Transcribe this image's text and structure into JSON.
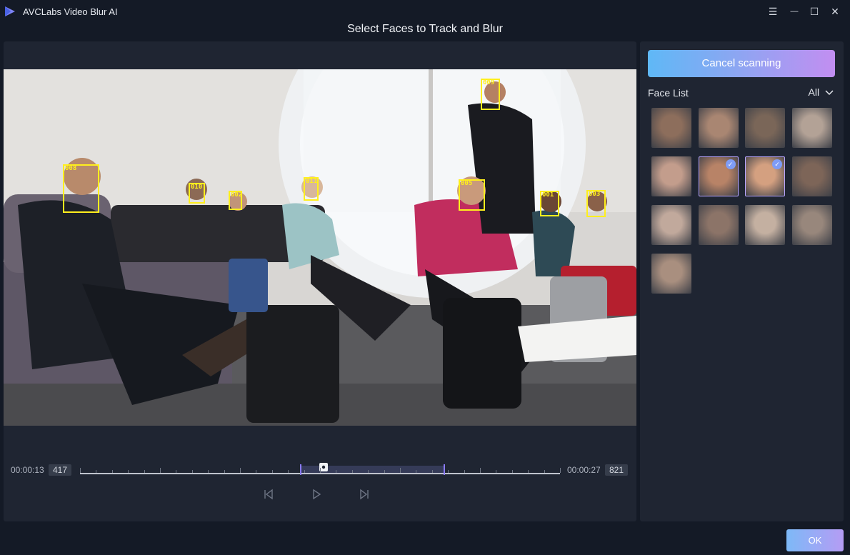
{
  "app": {
    "title": "AVCLabs Video Blur AI"
  },
  "page": {
    "title": "Select Faces to Track and Blur"
  },
  "window_controls": [
    {
      "name": "menu-icon",
      "glyph": "☰"
    },
    {
      "name": "minimize-icon",
      "glyph": "—"
    },
    {
      "name": "maximize-icon",
      "glyph": "☐"
    },
    {
      "name": "close-icon",
      "glyph": "✕"
    }
  ],
  "video": {
    "face_boxes": [
      "008",
      "010",
      "002",
      "011",
      "005",
      "009",
      "001",
      "003"
    ]
  },
  "timeline": {
    "start_time": "00:00:13",
    "start_frame": "417",
    "end_time": "00:00:27",
    "end_frame": "821"
  },
  "controls": {
    "prev": "skip-back-icon",
    "play": "play-icon",
    "next": "skip-forward-icon"
  },
  "side": {
    "cancel_label": "Cancel scanning",
    "face_list_label": "Face List",
    "filter_value": "All"
  },
  "faces": [
    {
      "selected": false,
      "color": "#8d6e5c"
    },
    {
      "selected": false,
      "color": "#a98672"
    },
    {
      "selected": false,
      "color": "#7a6658"
    },
    {
      "selected": false,
      "color": "#b3a296"
    },
    {
      "selected": false,
      "color": "#c39d8c"
    },
    {
      "selected": true,
      "color": "#b88367"
    },
    {
      "selected": true,
      "color": "#d4a080"
    },
    {
      "selected": false,
      "color": "#7d6558"
    },
    {
      "selected": false,
      "color": "#c1a99c"
    },
    {
      "selected": false,
      "color": "#8c7468"
    },
    {
      "selected": false,
      "color": "#c4b0a1"
    },
    {
      "selected": false,
      "color": "#98877c"
    },
    {
      "selected": false,
      "color": "#a98f7f"
    }
  ],
  "ok_label": "OK"
}
